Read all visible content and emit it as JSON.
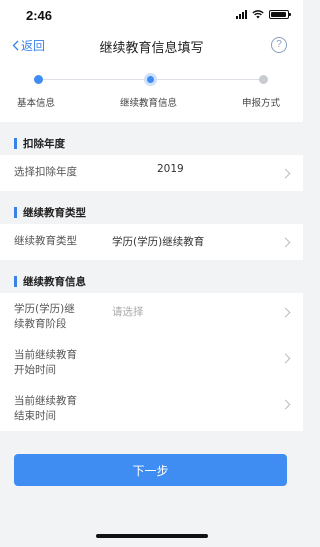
{
  "status": {
    "time": "2:46"
  },
  "nav": {
    "back_label": "返回",
    "title": "继续教育信息填写",
    "help_label": "?"
  },
  "steps": [
    {
      "label": "基本信息",
      "state": "done"
    },
    {
      "label": "继续教育信息",
      "state": "current"
    },
    {
      "label": "申报方式",
      "state": "pending"
    }
  ],
  "sections": {
    "year": {
      "title": "扣除年度",
      "row_label": "选择扣除年度",
      "row_value": "2019"
    },
    "type": {
      "title": "继续教育类型",
      "row_label": "继续教育类型",
      "row_value": "学历(学历)继续教育"
    },
    "info": {
      "title": "继续教育信息",
      "stage_label_1": "学历(学历)继",
      "stage_label_2": "续教育阶段",
      "stage_placeholder": "请选择",
      "start_label_1": "当前继续教育",
      "start_label_2": "开始时间",
      "end_label_1": "当前继续教育",
      "end_label_2": "结束时间"
    }
  },
  "next_button_label": "下一步",
  "colors": {
    "accent": "#3f8cf2",
    "step_pending": "#c8cbd0"
  }
}
